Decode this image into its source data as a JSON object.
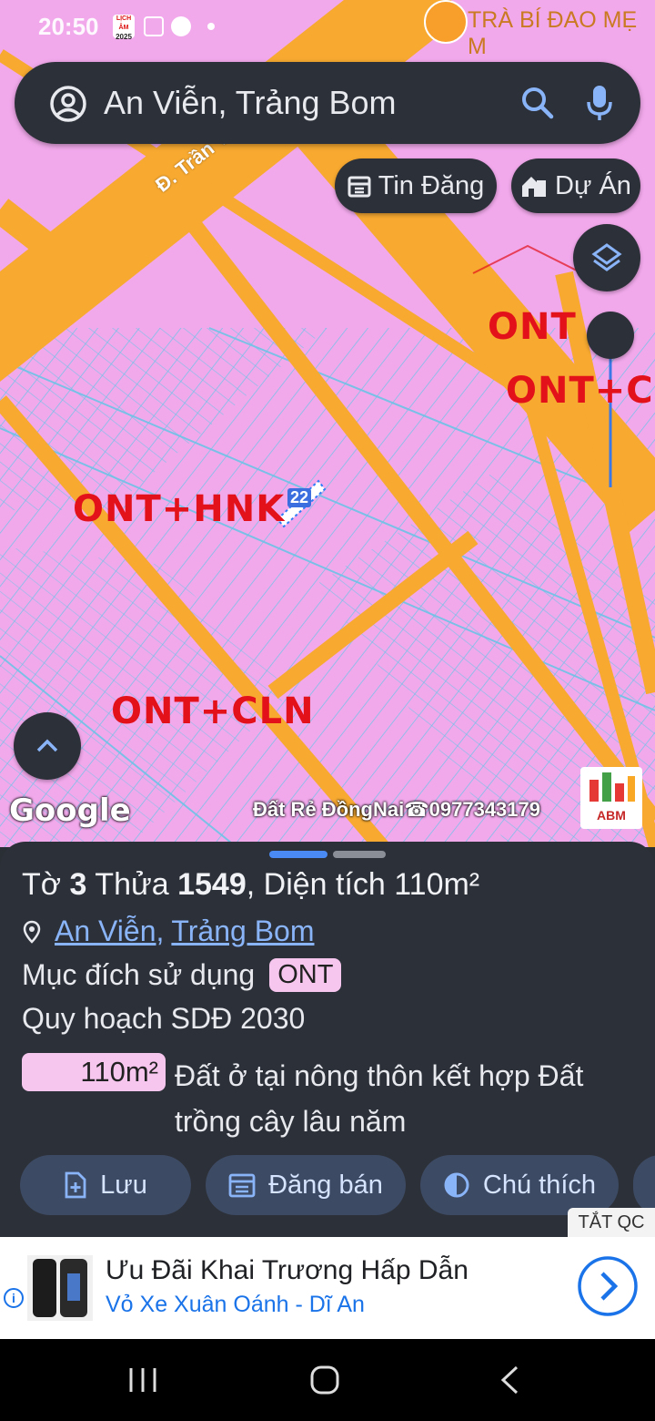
{
  "status_bar": {
    "time": "20:50",
    "calendar_badge": "2025",
    "calendar_top": "LỊCH ÂM"
  },
  "map": {
    "poi_label": "TRÀ BÍ ĐAO MẸ M",
    "street_label": "Đ. Trần Vi",
    "zone_labels": [
      "ONT",
      "ONT+CL",
      "ONT+HNK",
      "ONT+CLN"
    ],
    "parcel_tag": "22",
    "watermark": "Đất Rẻ ĐồngNai☎0977343179",
    "google_logo": "Google",
    "abm_text": "ABM"
  },
  "search": {
    "value": "An Viễn, Trảng Bom"
  },
  "chips": {
    "listings": "Tin Đăng",
    "projects": "Dự Án"
  },
  "panel": {
    "title_prefix": "Tờ",
    "sheet_no": "3",
    "parcel_word": "Thửa",
    "parcel_no": "1549",
    "area_prefix": ", Diện tích",
    "area": "110m²",
    "loc_commune": "An Viễn",
    "loc_sep": ",",
    "loc_district": "Trảng Bom",
    "purpose_label": "Mục đích sử dụng",
    "purpose_code": "ONT",
    "plan_label": "Quy hoạch SDĐ 2030",
    "plan_area": "110m²",
    "plan_desc": "Đất ở tại nông thôn kết hợp Đất trồng cây lâu năm",
    "buttons": {
      "save": "Lưu",
      "post_sale": "Đăng bán",
      "legend": "Chú thích"
    }
  },
  "ad": {
    "close_label": "TẮT QC",
    "title": "Ưu Đãi Khai Trương Hấp Dẫn",
    "subtitle": "Vỏ Xe Xuân Oánh - Dĩ An"
  },
  "colors": {
    "map_bg": "#f2a9ec",
    "road": "#f7a930",
    "parcel_line": "#6ec3e6",
    "zone_text": "#e3111a",
    "panel_bg": "#2c3038",
    "accent_blue": "#8ab4f8"
  }
}
